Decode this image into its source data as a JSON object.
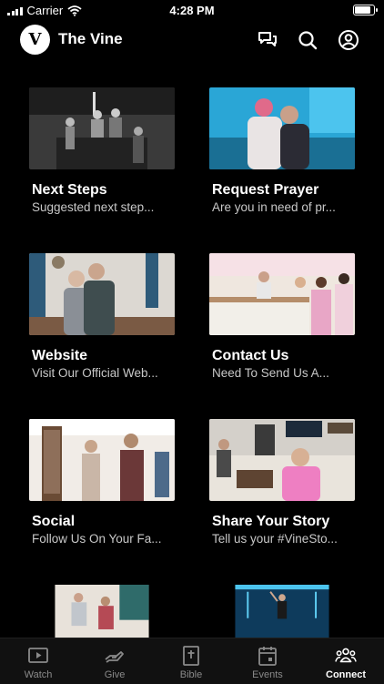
{
  "status": {
    "carrier": "Carrier",
    "time": "4:28 PM",
    "battery": 0.95
  },
  "header": {
    "logo_letter": "V",
    "title": "The Vine"
  },
  "cards": [
    {
      "title": "Next Steps",
      "subtitle": "Suggested next step..."
    },
    {
      "title": "Request Prayer",
      "subtitle": "Are you in need of pr..."
    },
    {
      "title": "Website",
      "subtitle": "Visit Our Official Web..."
    },
    {
      "title": "Contact Us",
      "subtitle": "Need To Send Us A..."
    },
    {
      "title": "Social",
      "subtitle": "Follow Us On Your Fa..."
    },
    {
      "title": "Share Your Story",
      "subtitle": "Tell us your #VineSto..."
    }
  ],
  "tabs": [
    {
      "label": "Watch",
      "icon": "play-icon"
    },
    {
      "label": "Give",
      "icon": "give-hand-icon"
    },
    {
      "label": "Bible",
      "icon": "bible-icon"
    },
    {
      "label": "Events",
      "icon": "calendar-icon"
    },
    {
      "label": "Connect",
      "icon": "people-icon",
      "active": true
    }
  ],
  "colors": {
    "background": "#000000",
    "tabbar": "#111111",
    "subtitle": "#c8c8c8",
    "inactive_tab": "#8a8a8a"
  }
}
